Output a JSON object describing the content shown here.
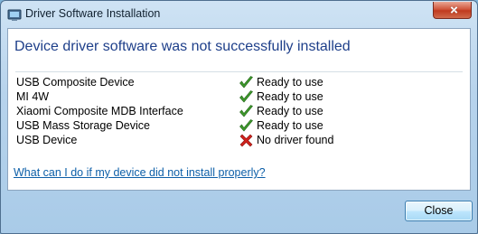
{
  "window": {
    "title": "Driver Software Installation",
    "icon": "device-installation-icon"
  },
  "main": {
    "heading": "Device driver software was not successfully installed",
    "devices": [
      {
        "name": "USB Composite Device",
        "status": "Ready to use",
        "status_icon": "check-icon"
      },
      {
        "name": "MI 4W",
        "status": "Ready to use",
        "status_icon": "check-icon"
      },
      {
        "name": "Xiaomi Composite MDB Interface",
        "status": "Ready to use",
        "status_icon": "check-icon"
      },
      {
        "name": "USB Mass Storage Device",
        "status": "Ready to use",
        "status_icon": "check-icon"
      },
      {
        "name": "USB Device",
        "status": "No driver found",
        "status_icon": "error-x-icon"
      }
    ],
    "help_link": "What can I do if my device did not install properly?"
  },
  "footer": {
    "close_label": "Close"
  },
  "colors": {
    "heading": "#1e3f8a",
    "link": "#0d5fa8",
    "check": "#3f9a2c",
    "error": "#d0211c"
  }
}
